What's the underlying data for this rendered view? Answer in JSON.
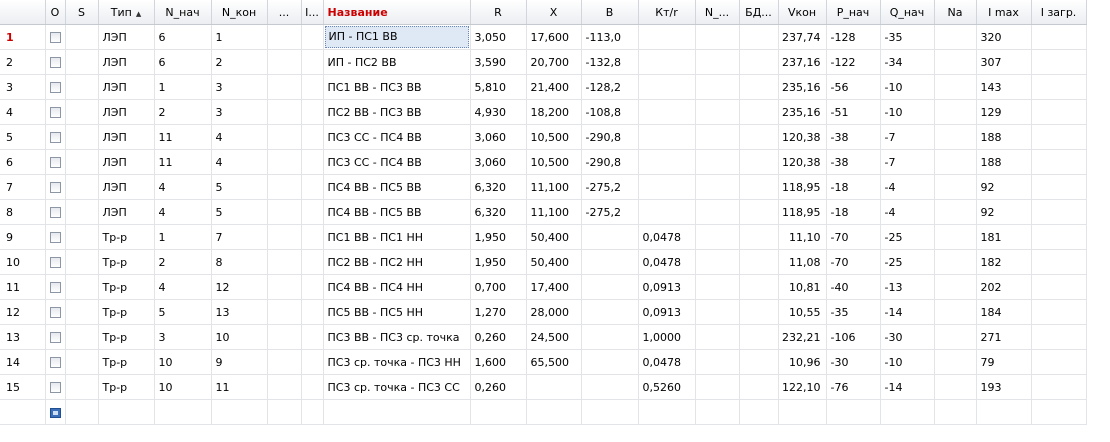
{
  "columns": [
    "О",
    "S",
    "Тип",
    "N_нач",
    "N_кон",
    "...",
    "I...",
    "Название",
    "R",
    "X",
    "B",
    "Кт/r",
    "N_...",
    "БД...",
    "Vкон",
    "P_нач",
    "Q_нач",
    "Na",
    "I max",
    "I загр."
  ],
  "rows": [
    {
      "num": "1",
      "type": "ЛЭП",
      "n_start": "6",
      "n_end": "1",
      "name": "ИП - ПС1 ВВ",
      "r": "3,050",
      "x": "17,600",
      "b": "-113,0",
      "kt": "",
      "v_end": "237,74",
      "p_start": "-128",
      "q_start": "-35",
      "i_max": "320"
    },
    {
      "num": "2",
      "type": "ЛЭП",
      "n_start": "6",
      "n_end": "2",
      "name": "ИП - ПС2 ВВ",
      "r": "3,590",
      "x": "20,700",
      "b": "-132,8",
      "kt": "",
      "v_end": "237,16",
      "p_start": "-122",
      "q_start": "-34",
      "i_max": "307"
    },
    {
      "num": "3",
      "type": "ЛЭП",
      "n_start": "1",
      "n_end": "3",
      "name": "ПС1 ВВ - ПС3 ВВ",
      "r": "5,810",
      "x": "21,400",
      "b": "-128,2",
      "kt": "",
      "v_end": "235,16",
      "p_start": "-56",
      "q_start": "-10",
      "i_max": "143"
    },
    {
      "num": "4",
      "type": "ЛЭП",
      "n_start": "2",
      "n_end": "3",
      "name": "ПС2 ВВ - ПС3 ВВ",
      "r": "4,930",
      "x": "18,200",
      "b": "-108,8",
      "kt": "",
      "v_end": "235,16",
      "p_start": "-51",
      "q_start": "-10",
      "i_max": "129"
    },
    {
      "num": "5",
      "type": "ЛЭП",
      "n_start": "11",
      "n_end": "4",
      "name": "ПС3 СС - ПС4 ВВ",
      "r": "3,060",
      "x": "10,500",
      "b": "-290,8",
      "kt": "",
      "v_end": "120,38",
      "p_start": "-38",
      "q_start": "-7",
      "i_max": "188"
    },
    {
      "num": "6",
      "type": "ЛЭП",
      "n_start": "11",
      "n_end": "4",
      "name": "ПС3 СС - ПС4 ВВ",
      "r": "3,060",
      "x": "10,500",
      "b": "-290,8",
      "kt": "",
      "v_end": "120,38",
      "p_start": "-38",
      "q_start": "-7",
      "i_max": "188"
    },
    {
      "num": "7",
      "type": "ЛЭП",
      "n_start": "4",
      "n_end": "5",
      "name": "ПС4 ВВ - ПС5 ВВ",
      "r": "6,320",
      "x": "11,100",
      "b": "-275,2",
      "kt": "",
      "v_end": "118,95",
      "p_start": "-18",
      "q_start": "-4",
      "i_max": "92"
    },
    {
      "num": "8",
      "type": "ЛЭП",
      "n_start": "4",
      "n_end": "5",
      "name": "ПС4 ВВ - ПС5 ВВ",
      "r": "6,320",
      "x": "11,100",
      "b": "-275,2",
      "kt": "",
      "v_end": "118,95",
      "p_start": "-18",
      "q_start": "-4",
      "i_max": "92"
    },
    {
      "num": "9",
      "type": "Тр-р",
      "n_start": "1",
      "n_end": "7",
      "name": "ПС1 ВВ - ПС1 НН",
      "r": "1,950",
      "x": "50,400",
      "b": "",
      "kt": "0,0478",
      "v_end": "11,10",
      "p_start": "-70",
      "q_start": "-25",
      "i_max": "181"
    },
    {
      "num": "10",
      "type": "Тр-р",
      "n_start": "2",
      "n_end": "8",
      "name": "ПС2 ВВ - ПС2 НН",
      "r": "1,950",
      "x": "50,400",
      "b": "",
      "kt": "0,0478",
      "v_end": "11,08",
      "p_start": "-70",
      "q_start": "-25",
      "i_max": "182"
    },
    {
      "num": "11",
      "type": "Тр-р",
      "n_start": "4",
      "n_end": "12",
      "name": "ПС4 ВВ - ПС4 НН",
      "r": "0,700",
      "x": "17,400",
      "b": "",
      "kt": "0,0913",
      "v_end": "10,81",
      "p_start": "-40",
      "q_start": "-13",
      "i_max": "202"
    },
    {
      "num": "12",
      "type": "Тр-р",
      "n_start": "5",
      "n_end": "13",
      "name": "ПС5 ВВ - ПС5 НН",
      "r": "1,270",
      "x": "28,000",
      "b": "",
      "kt": "0,0913",
      "v_end": "10,55",
      "p_start": "-35",
      "q_start": "-14",
      "i_max": "184"
    },
    {
      "num": "13",
      "type": "Тр-р",
      "n_start": "3",
      "n_end": "10",
      "name": "ПС3 ВВ - ПС3 ср. точка",
      "r": "0,260",
      "x": "24,500",
      "b": "",
      "kt": "1,0000",
      "v_end": "232,21",
      "p_start": "-106",
      "q_start": "-30",
      "i_max": "271"
    },
    {
      "num": "14",
      "type": "Тр-р",
      "n_start": "10",
      "n_end": "9",
      "name": "ПС3 ср. точка - ПС3 НН",
      "r": "1,600",
      "x": "65,500",
      "b": "",
      "kt": "0,0478",
      "v_end": "10,96",
      "p_start": "-30",
      "q_start": "-10",
      "i_max": "79"
    },
    {
      "num": "15",
      "type": "Тр-р",
      "n_start": "10",
      "n_end": "11",
      "name": "ПС3 ср. точка - ПС3 СС",
      "r": "0,260",
      "x": "",
      "b": "",
      "kt": "0,5260",
      "v_end": "122,10",
      "p_start": "-76",
      "q_start": "-14",
      "i_max": "193"
    }
  ],
  "selected_row": "1",
  "colors": {
    "accent_red": "#cc0000",
    "selection_bg": "#dfe9f6",
    "selection_border": "#6b87b5",
    "grid_line": "#e2e4e8"
  },
  "icons": {
    "sort": "sort-ascending-icon",
    "checkbox": "checkbox-icon",
    "new_row": "new-row-icon"
  }
}
